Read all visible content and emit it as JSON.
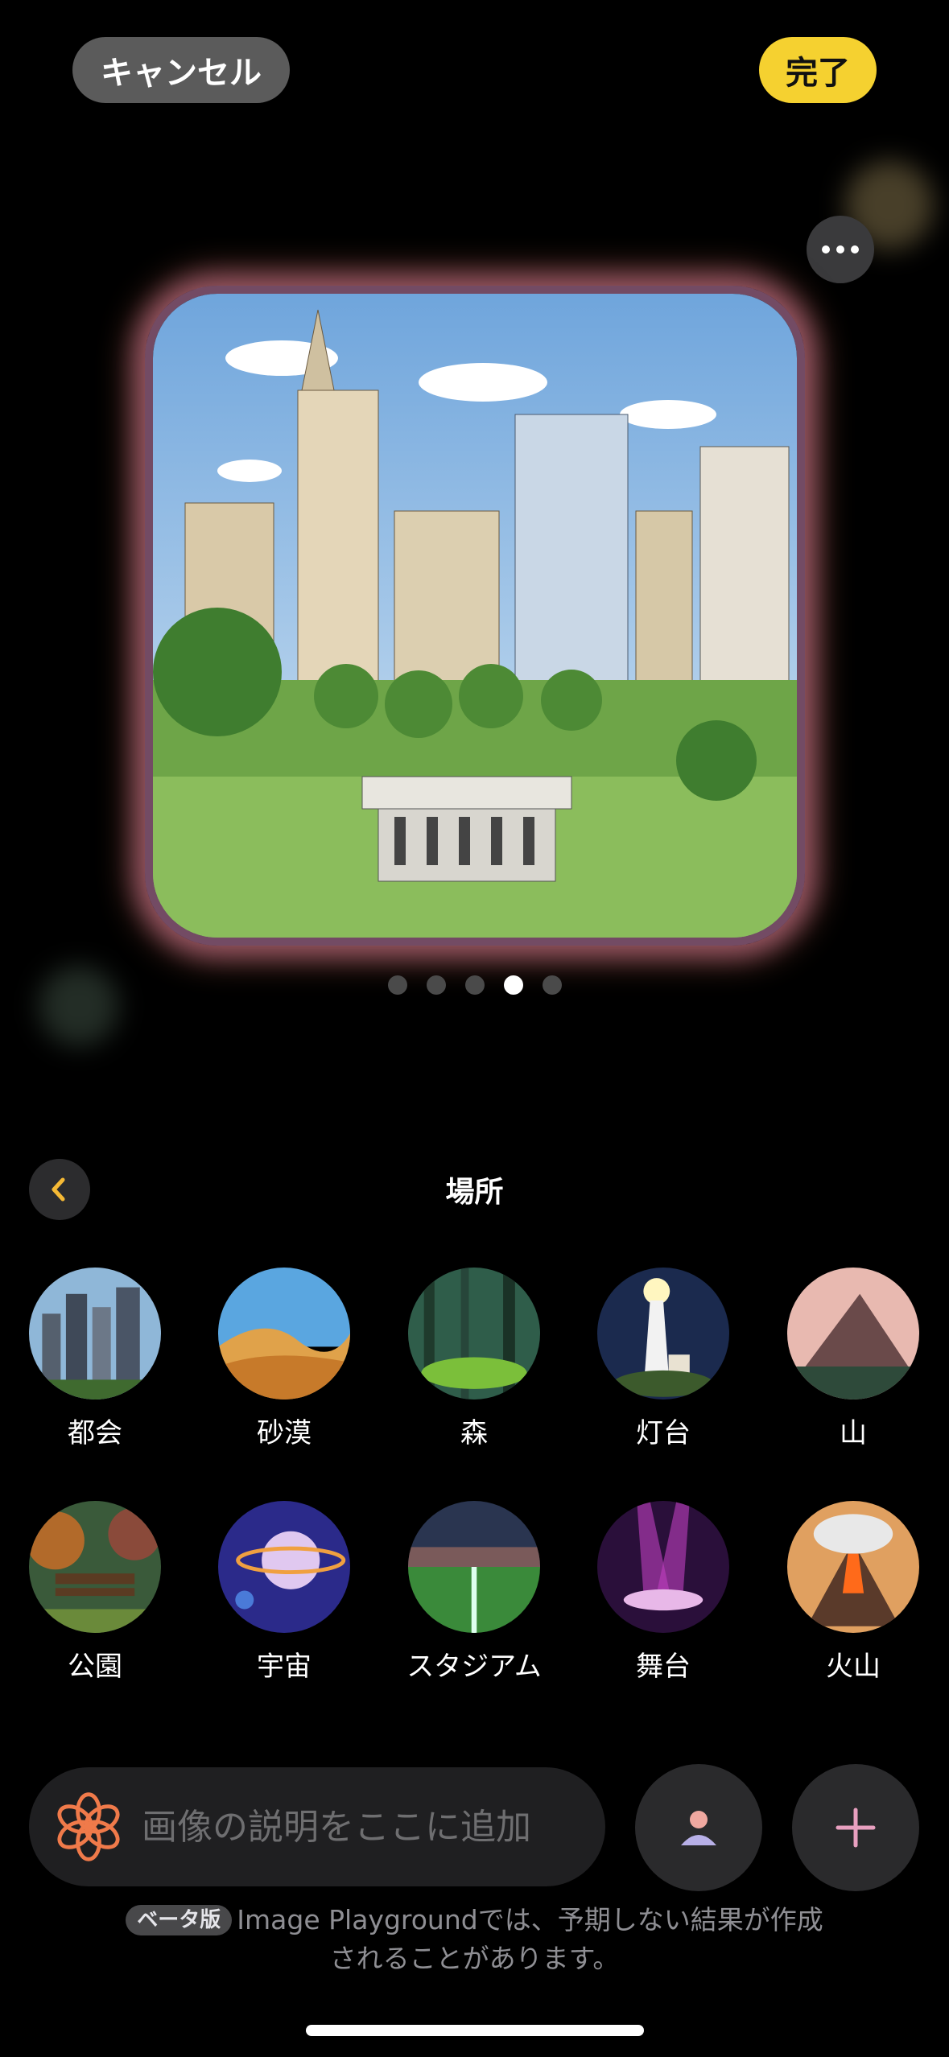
{
  "header": {
    "cancel_label": "キャンセル",
    "done_label": "完了"
  },
  "preview": {
    "page_count": 5,
    "active_page": 4,
    "more_icon": "ellipsis-icon"
  },
  "section": {
    "title": "場所",
    "back_icon": "chevron-left-icon"
  },
  "categories": [
    {
      "label": "都会"
    },
    {
      "label": "砂漠"
    },
    {
      "label": "森"
    },
    {
      "label": "灯台"
    },
    {
      "label": "山"
    },
    {
      "label": "公園"
    },
    {
      "label": "宇宙"
    },
    {
      "label": "スタジアム"
    },
    {
      "label": "舞台"
    },
    {
      "label": "火山"
    }
  ],
  "prompt": {
    "placeholder": "画像の説明をここに追加",
    "value": ""
  },
  "footer": {
    "badge": "ベータ版",
    "line1": "Image Playgroundでは、予期しない結果が作成",
    "line2": "されることがあります。"
  },
  "colors": {
    "accent": "#f5d130",
    "background": "#000000",
    "chevron": "#f5b935"
  }
}
